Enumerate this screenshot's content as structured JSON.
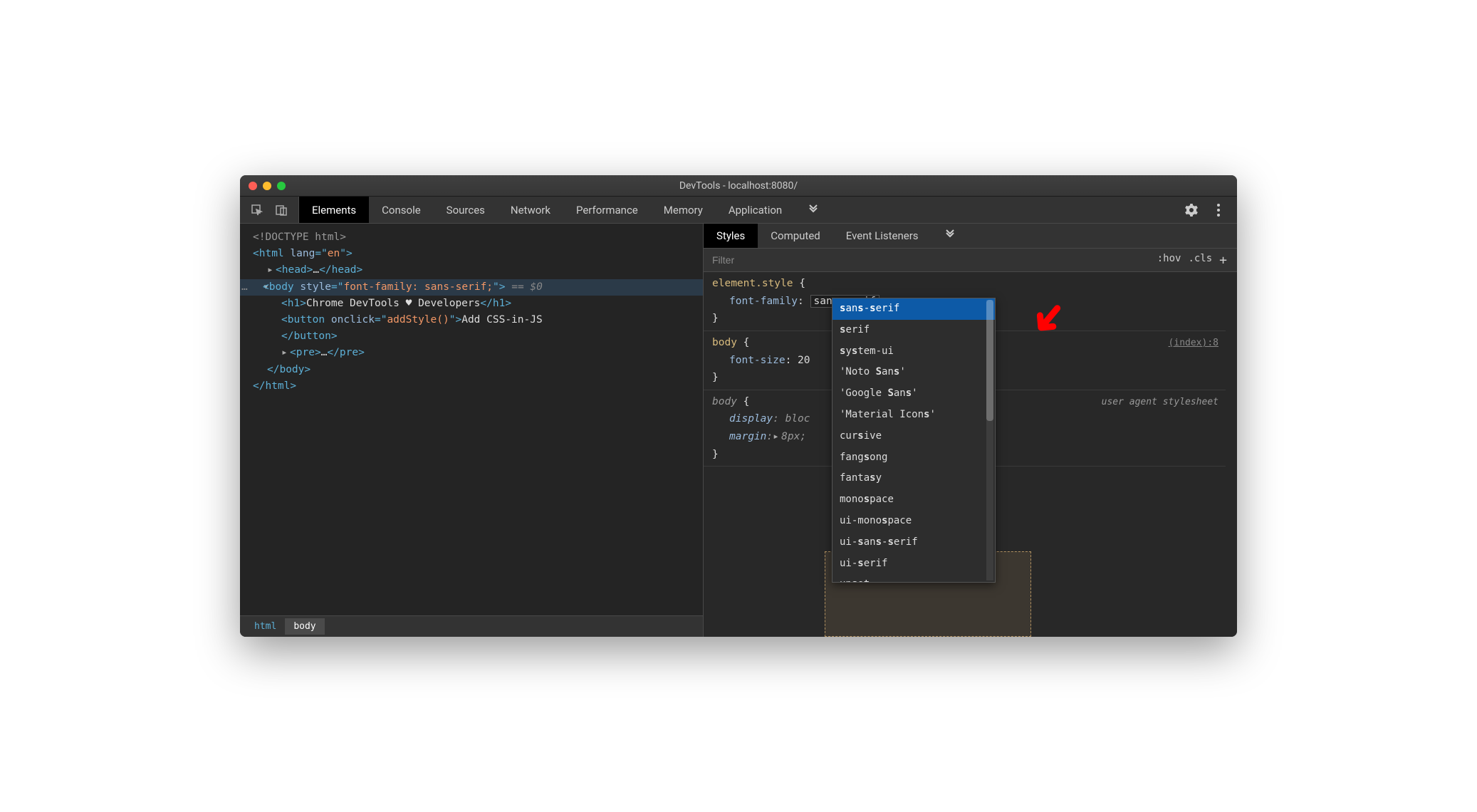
{
  "window": {
    "title": "DevTools - localhost:8080/"
  },
  "toolbar": {
    "tabs": [
      "Elements",
      "Console",
      "Sources",
      "Network",
      "Performance",
      "Memory",
      "Application"
    ],
    "active_tab": "Elements"
  },
  "dom": {
    "doctype": "<!DOCTYPE html>",
    "html_open": {
      "tag": "html",
      "attr_name": "lang",
      "attr_value": "en"
    },
    "head": {
      "tag": "head",
      "ellipsis": "…"
    },
    "body_open": {
      "tag": "body",
      "attr_name": "style",
      "attr_value": "font-family: sans-serif;",
      "eq0": "== $0"
    },
    "h1": {
      "tag": "h1",
      "text": "Chrome DevTools ♥ Developers"
    },
    "button": {
      "tag": "button",
      "attr_name": "onclick",
      "attr_value": "addStyle()",
      "text": "Add CSS-in-JS"
    },
    "pre": {
      "tag": "pre",
      "ellipsis": "…"
    },
    "body_close": "body",
    "html_close": "html"
  },
  "breadcrumbs": [
    "html",
    "body"
  ],
  "styles": {
    "tabs": [
      "Styles",
      "Computed",
      "Event Listeners"
    ],
    "active_tab": "Styles",
    "filter_placeholder": "Filter",
    "filter_buttons": {
      "hov": ":hov",
      "cls": ".cls",
      "plus": "+"
    },
    "rules": [
      {
        "selector": "element.style",
        "props": [
          {
            "name": "font-family",
            "value": "sans-serif",
            "editing": true
          }
        ]
      },
      {
        "selector": "body",
        "source_link": "(index):8",
        "props": [
          {
            "name": "font-size",
            "value": "20"
          }
        ]
      },
      {
        "selector": "body",
        "italic": true,
        "source_text": "user agent stylesheet",
        "props": [
          {
            "name": "display",
            "value": "bloc",
            "italic": true
          },
          {
            "name": "margin",
            "value": "8px",
            "italic": true,
            "expand": true
          }
        ]
      }
    ],
    "autocomplete": [
      "sans-serif",
      "serif",
      "system-ui",
      "'Noto Sans'",
      "'Google Sans'",
      "'Material Icons'",
      "cursive",
      "fangsong",
      "fantasy",
      "monospace",
      "ui-monospace",
      "ui-sans-serif",
      "ui-serif",
      "unset"
    ],
    "autocomplete_selected": 0
  }
}
